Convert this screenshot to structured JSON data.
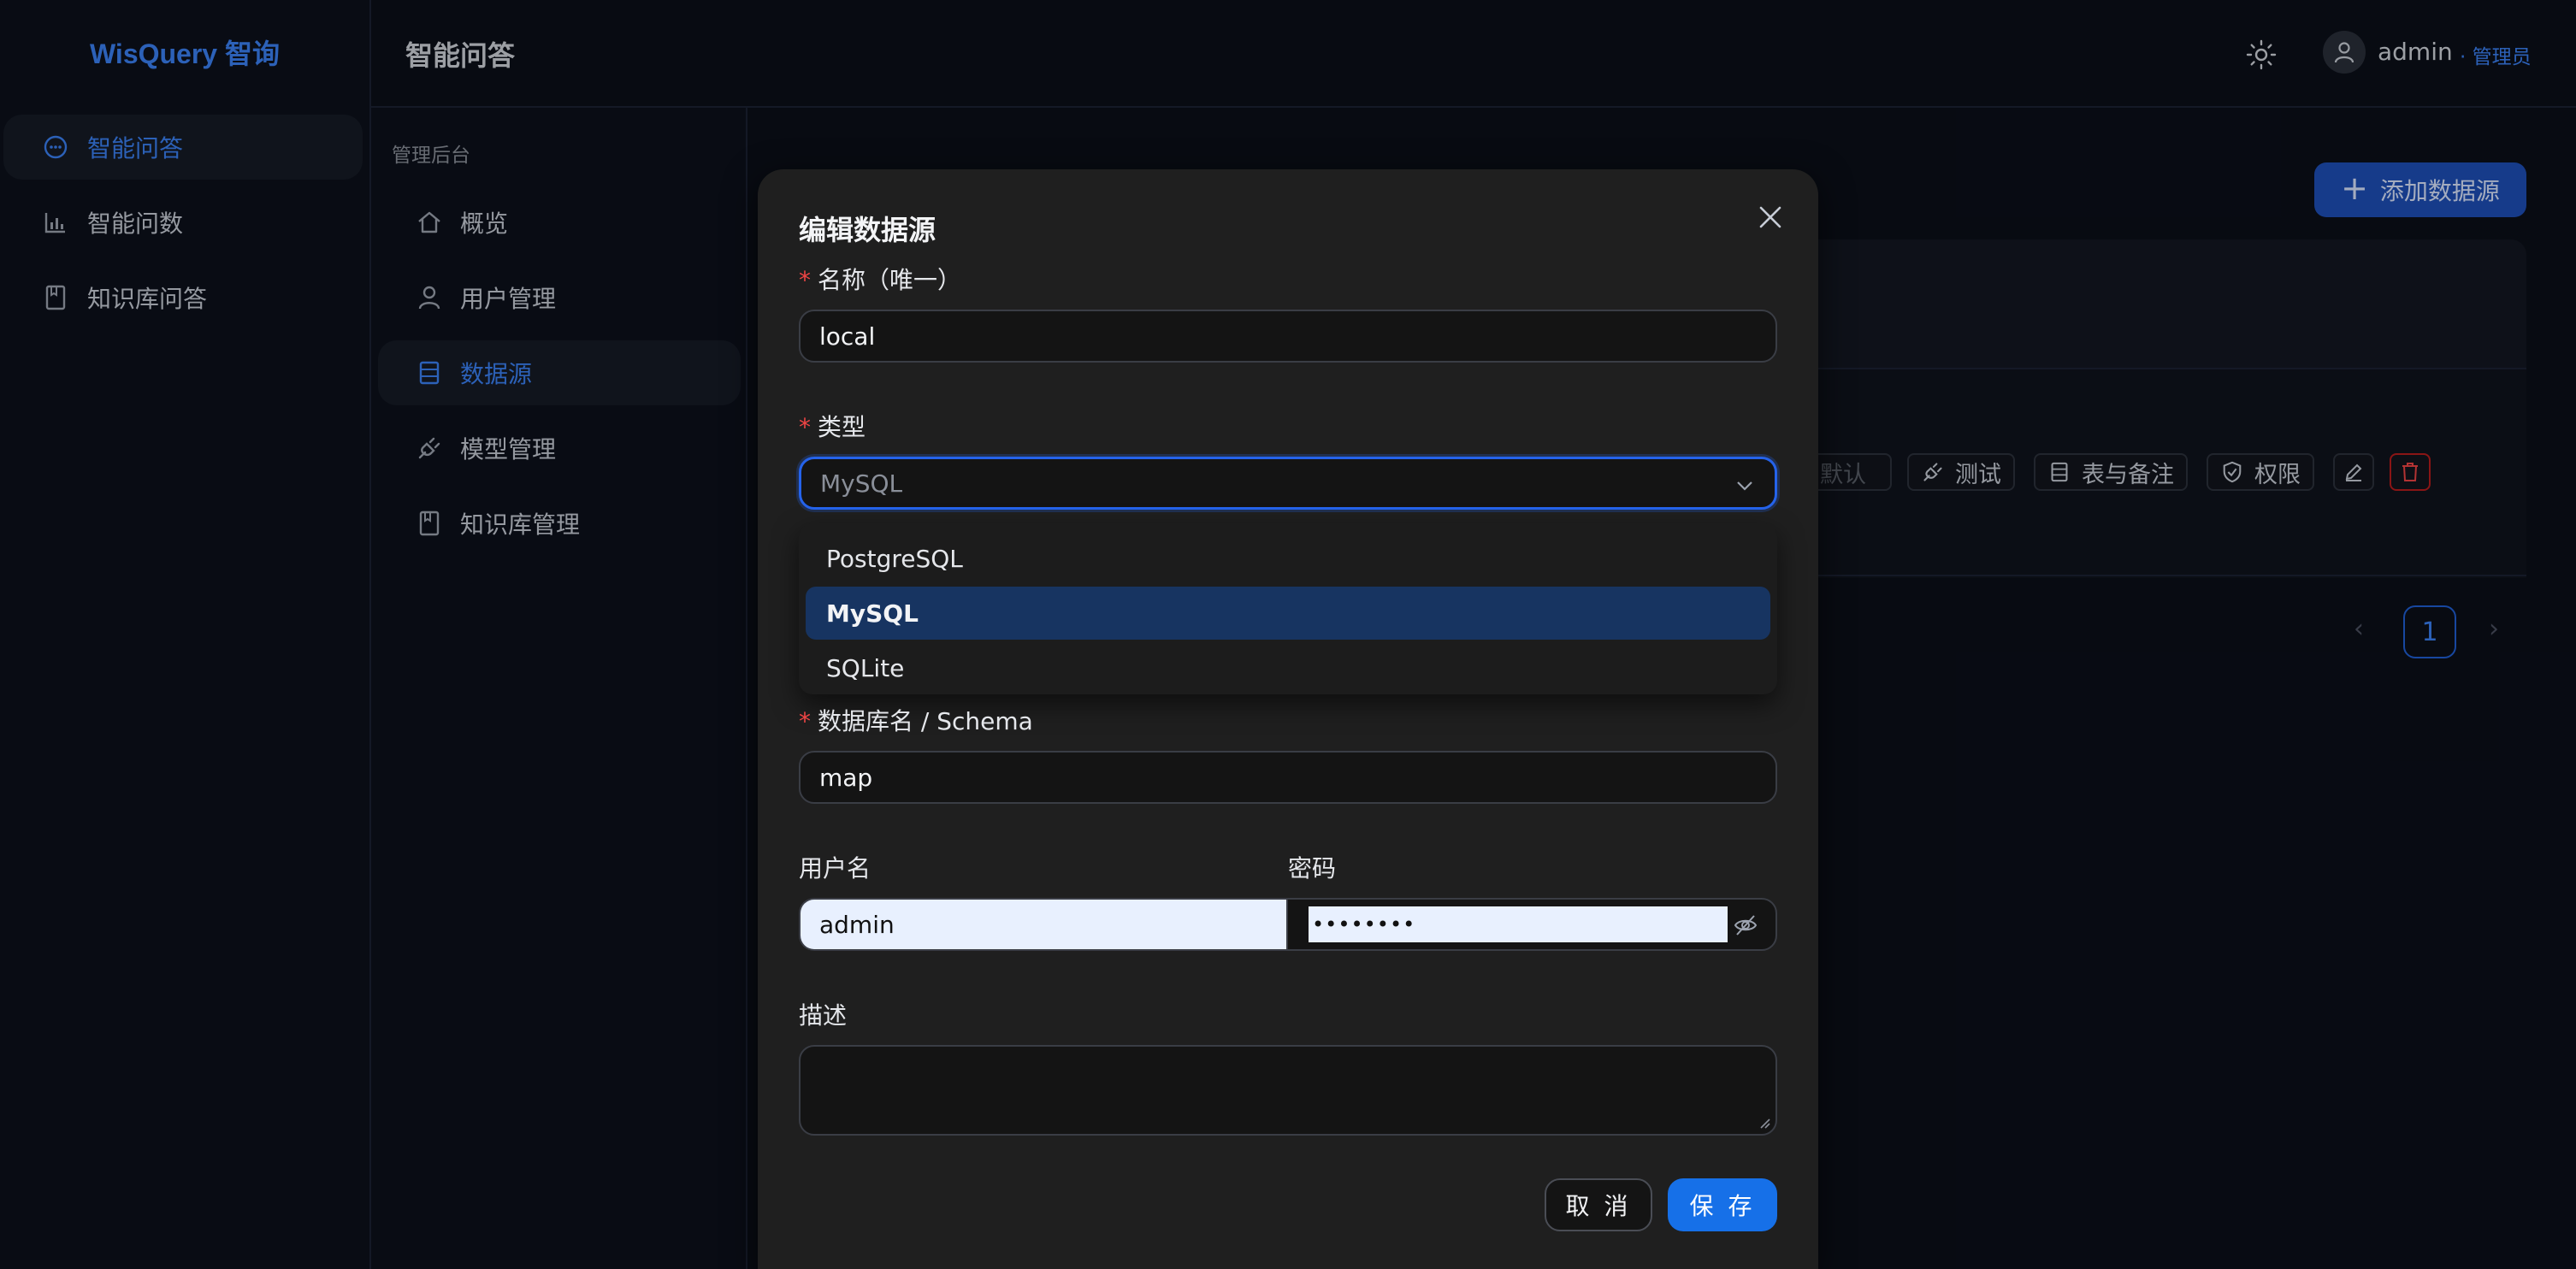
{
  "app": {
    "brand": "WisQuery 智询"
  },
  "sidebar": {
    "items": [
      {
        "label": "智能问答",
        "icon": "chat-bubble-icon",
        "active": true
      },
      {
        "label": "智能问数",
        "icon": "bar-chart-icon",
        "active": false
      },
      {
        "label": "知识库问答",
        "icon": "book-icon",
        "active": false
      }
    ]
  },
  "header": {
    "title": "智能问答",
    "username": "admin",
    "role": "· 管理员",
    "theme_icon": "sun-icon"
  },
  "admin_nav": {
    "title": "管理后台",
    "items": [
      {
        "label": "概览",
        "icon": "home-icon"
      },
      {
        "label": "用户管理",
        "icon": "user-icon"
      },
      {
        "label": "数据源",
        "icon": "database-icon",
        "active": true
      },
      {
        "label": "模型管理",
        "icon": "plug-icon"
      },
      {
        "label": "知识库管理",
        "icon": "book-icon"
      }
    ]
  },
  "background": {
    "add_button": "添加数据源",
    "row_actions": {
      "set_default": "设为默认",
      "test": "测试",
      "tables_notes": "表与备注",
      "permissions": "权限"
    },
    "pagination": {
      "current": "1"
    }
  },
  "modal": {
    "title": "编辑数据源",
    "name": {
      "label": "名称（唯一）",
      "value": "local"
    },
    "type": {
      "label": "类型",
      "value": "MySQL",
      "options": [
        "PostgreSQL",
        "MySQL",
        "SQLite"
      ],
      "selected_index": 1
    },
    "database": {
      "label": "数据库名 / Schema",
      "value": "map"
    },
    "username": {
      "label": "用户名",
      "value": "admin"
    },
    "password": {
      "label": "密码",
      "value": "••••••••"
    },
    "description": {
      "label": "描述",
      "value": ""
    },
    "cancel": "取 消",
    "save": "保 存"
  },
  "colors": {
    "accent": "#3b82f6",
    "primary_button": "#1670e8",
    "danger": "#ef4444",
    "selected_option": "#173461"
  }
}
